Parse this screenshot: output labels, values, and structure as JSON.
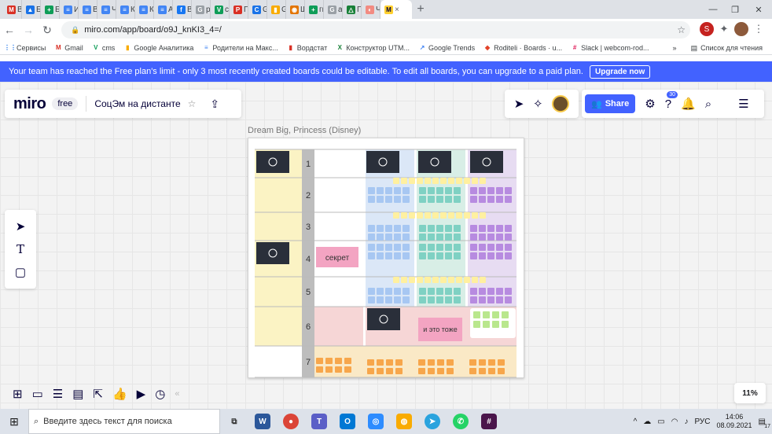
{
  "browser": {
    "tabs": [
      {
        "title": "Вх",
        "color": "#d93025",
        "glyph": "M"
      },
      {
        "title": "БК",
        "color": "#1a73e8",
        "glyph": "▲"
      },
      {
        "title": "Бк",
        "color": "#0f9d58",
        "glyph": "+"
      },
      {
        "title": "Ир",
        "color": "#4285f4",
        "glyph": "≡"
      },
      {
        "title": "Ве",
        "color": "#4285f4",
        "glyph": "≡"
      },
      {
        "title": "Чт",
        "color": "#4285f4",
        "glyph": "≡"
      },
      {
        "title": "Кс",
        "color": "#4285f4",
        "glyph": "≡"
      },
      {
        "title": "Кс",
        "color": "#4285f4",
        "glyph": "≡"
      },
      {
        "title": "Ав",
        "color": "#4285f4",
        "glyph": "≡"
      },
      {
        "title": "Ва",
        "color": "#1877f2",
        "glyph": "f"
      },
      {
        "title": "ра",
        "color": "#9aa0a6",
        "glyph": "G"
      },
      {
        "title": "сп",
        "color": "#0f9d58",
        "glyph": "V"
      },
      {
        "title": "Пс",
        "color": "#d93025",
        "glyph": "Р"
      },
      {
        "title": "Gc",
        "color": "#1a73e8",
        "glyph": "C"
      },
      {
        "title": "Gc",
        "color": "#f9ab00",
        "glyph": "▮"
      },
      {
        "title": "Ш",
        "color": "#e37400",
        "glyph": "◉"
      },
      {
        "title": "ги",
        "color": "#0f9d58",
        "glyph": "+"
      },
      {
        "title": "ар",
        "color": "#9aa0a6",
        "glyph": "G"
      },
      {
        "title": "Пс",
        "color": "#188038",
        "glyph": "△"
      },
      {
        "title": "Чт",
        "color": "#f28b82",
        "glyph": "◐"
      }
    ],
    "active_tab_icon": "miro-icon",
    "active_tab_close": "×",
    "new_tab": "+",
    "url": "miro.com/app/board/o9J_knKI3_4=/",
    "bookmarks": [
      {
        "label": "Сервисы",
        "color": "#1a73e8",
        "glyph": "⋮⋮"
      },
      {
        "label": "Gmail",
        "color": "#d93025",
        "glyph": "M"
      },
      {
        "label": "cms",
        "color": "#0f9d58",
        "glyph": "V"
      },
      {
        "label": "Google Аналитика",
        "color": "#f9ab00",
        "glyph": "▮"
      },
      {
        "label": "Родители на Макс...",
        "color": "#4285f4",
        "glyph": "≡"
      },
      {
        "label": "Вордстат",
        "color": "#d93025",
        "glyph": "▮"
      },
      {
        "label": "Конструктор UTM...",
        "color": "#188038",
        "glyph": "X"
      },
      {
        "label": "Google Trends",
        "color": "#4285f4",
        "glyph": "↗"
      },
      {
        "label": "Roditeli · Boards · u...",
        "color": "#e24329",
        "glyph": "◆"
      },
      {
        "label": "Slack | webcom-rod...",
        "color": "#e01e5a",
        "glyph": "#"
      }
    ],
    "bookmarks_more": "»",
    "reading_list": "Список для чтения"
  },
  "banner": {
    "text": "Your team has reached the Free plan's limit - only 3 most recently created boards could be editable. To edit all boards, you can upgrade to a paid plan.",
    "button": "Upgrade now"
  },
  "board": {
    "logo": "miro",
    "plan": "free",
    "name": "СоцЭм на дистанте",
    "frame_title": "Dream Big, Princess (Disney)",
    "share_label": "Share",
    "notifications_count": "30",
    "zoom": "11%",
    "rows": [
      "1",
      "2",
      "3",
      "4",
      "5",
      "6",
      "7"
    ],
    "sticky_secret": "секрет",
    "sticky_also": "и это тоже"
  },
  "colors": {
    "accent": "#4262ff",
    "col_blue": "#dbe7f7",
    "col_teal": "#d8eee6",
    "col_purple": "#e7dcf2",
    "col_yellow": "#fbf3c4",
    "row7": "#fae9c6",
    "pink_note": "#f3a4c2"
  },
  "taskbar": {
    "search_placeholder": "Введите здесь текст для поиска",
    "language": "РУС",
    "time": "14:06",
    "date": "08.09.2021",
    "notification_count": "17"
  }
}
